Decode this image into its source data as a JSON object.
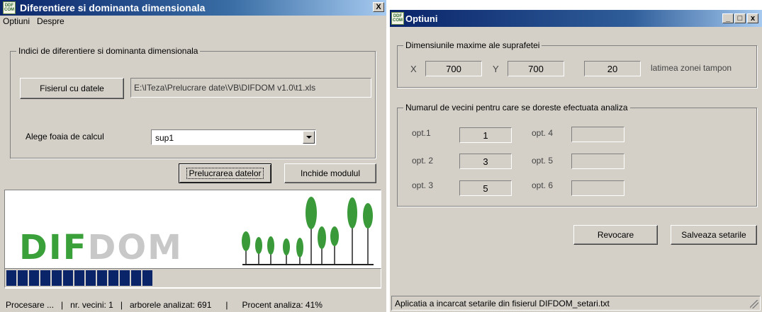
{
  "left_window": {
    "title": "Diferentiere si dominanta dimensionala",
    "close_label": "X",
    "menu": [
      "Optiuni",
      "Despre"
    ],
    "group_title": "Indici de diferentiere si dominanta dimensionala",
    "file_button": "Fisierul cu datele",
    "file_path": "E:\\ITeza\\Prelucrare date\\VB\\DIFDOM v1.0\\t1.xls",
    "sheet_label": "Alege foaia de calcul",
    "sheet_value": "sup1",
    "process_button": "Prelucrarea datelor",
    "close_button": "Inchide modulul",
    "logo_text": "DIFDOM",
    "progress_percent": 41,
    "status": {
      "processing": "Procesare ...",
      "neighbors": "nr. vecini: 1",
      "tree": "arborele analizat: 691",
      "percent": "Procent analiza: 41%"
    },
    "colors": {
      "title_bar_start": "#0a246a",
      "title_bar_end": "#a6caf0",
      "progress": "#0a246a",
      "tree": "#3a9a3a",
      "logo_green": "#3aa03a",
      "logo_gray": "#c8c8c8"
    }
  },
  "right_window": {
    "title": "Optiuni",
    "min_label": "_",
    "max_label": "□",
    "close_label": "x",
    "dims_group_title": "Dimensiunile maxime ale suprafetei",
    "x_label": "X",
    "x_value": "700",
    "y_label": "Y",
    "y_value": "700",
    "buffer_value": "20",
    "buffer_label": "latimea zonei tampon",
    "neighbors_group_title": "Numarul de vecini pentru care se doreste efectuata analiza",
    "options": [
      {
        "label": "opt.1",
        "value": "1"
      },
      {
        "label": "opt. 2",
        "value": "3"
      },
      {
        "label": "opt. 3",
        "value": "5"
      },
      {
        "label": "opt. 4",
        "value": ""
      },
      {
        "label": "opt. 5",
        "value": ""
      },
      {
        "label": "opt. 6",
        "value": ""
      }
    ],
    "cancel_button": "Revocare",
    "save_button": "Salveaza setarile",
    "status_text": "Aplicatia a incarcat setarile din fisierul DIFDOM_setari.txt"
  }
}
